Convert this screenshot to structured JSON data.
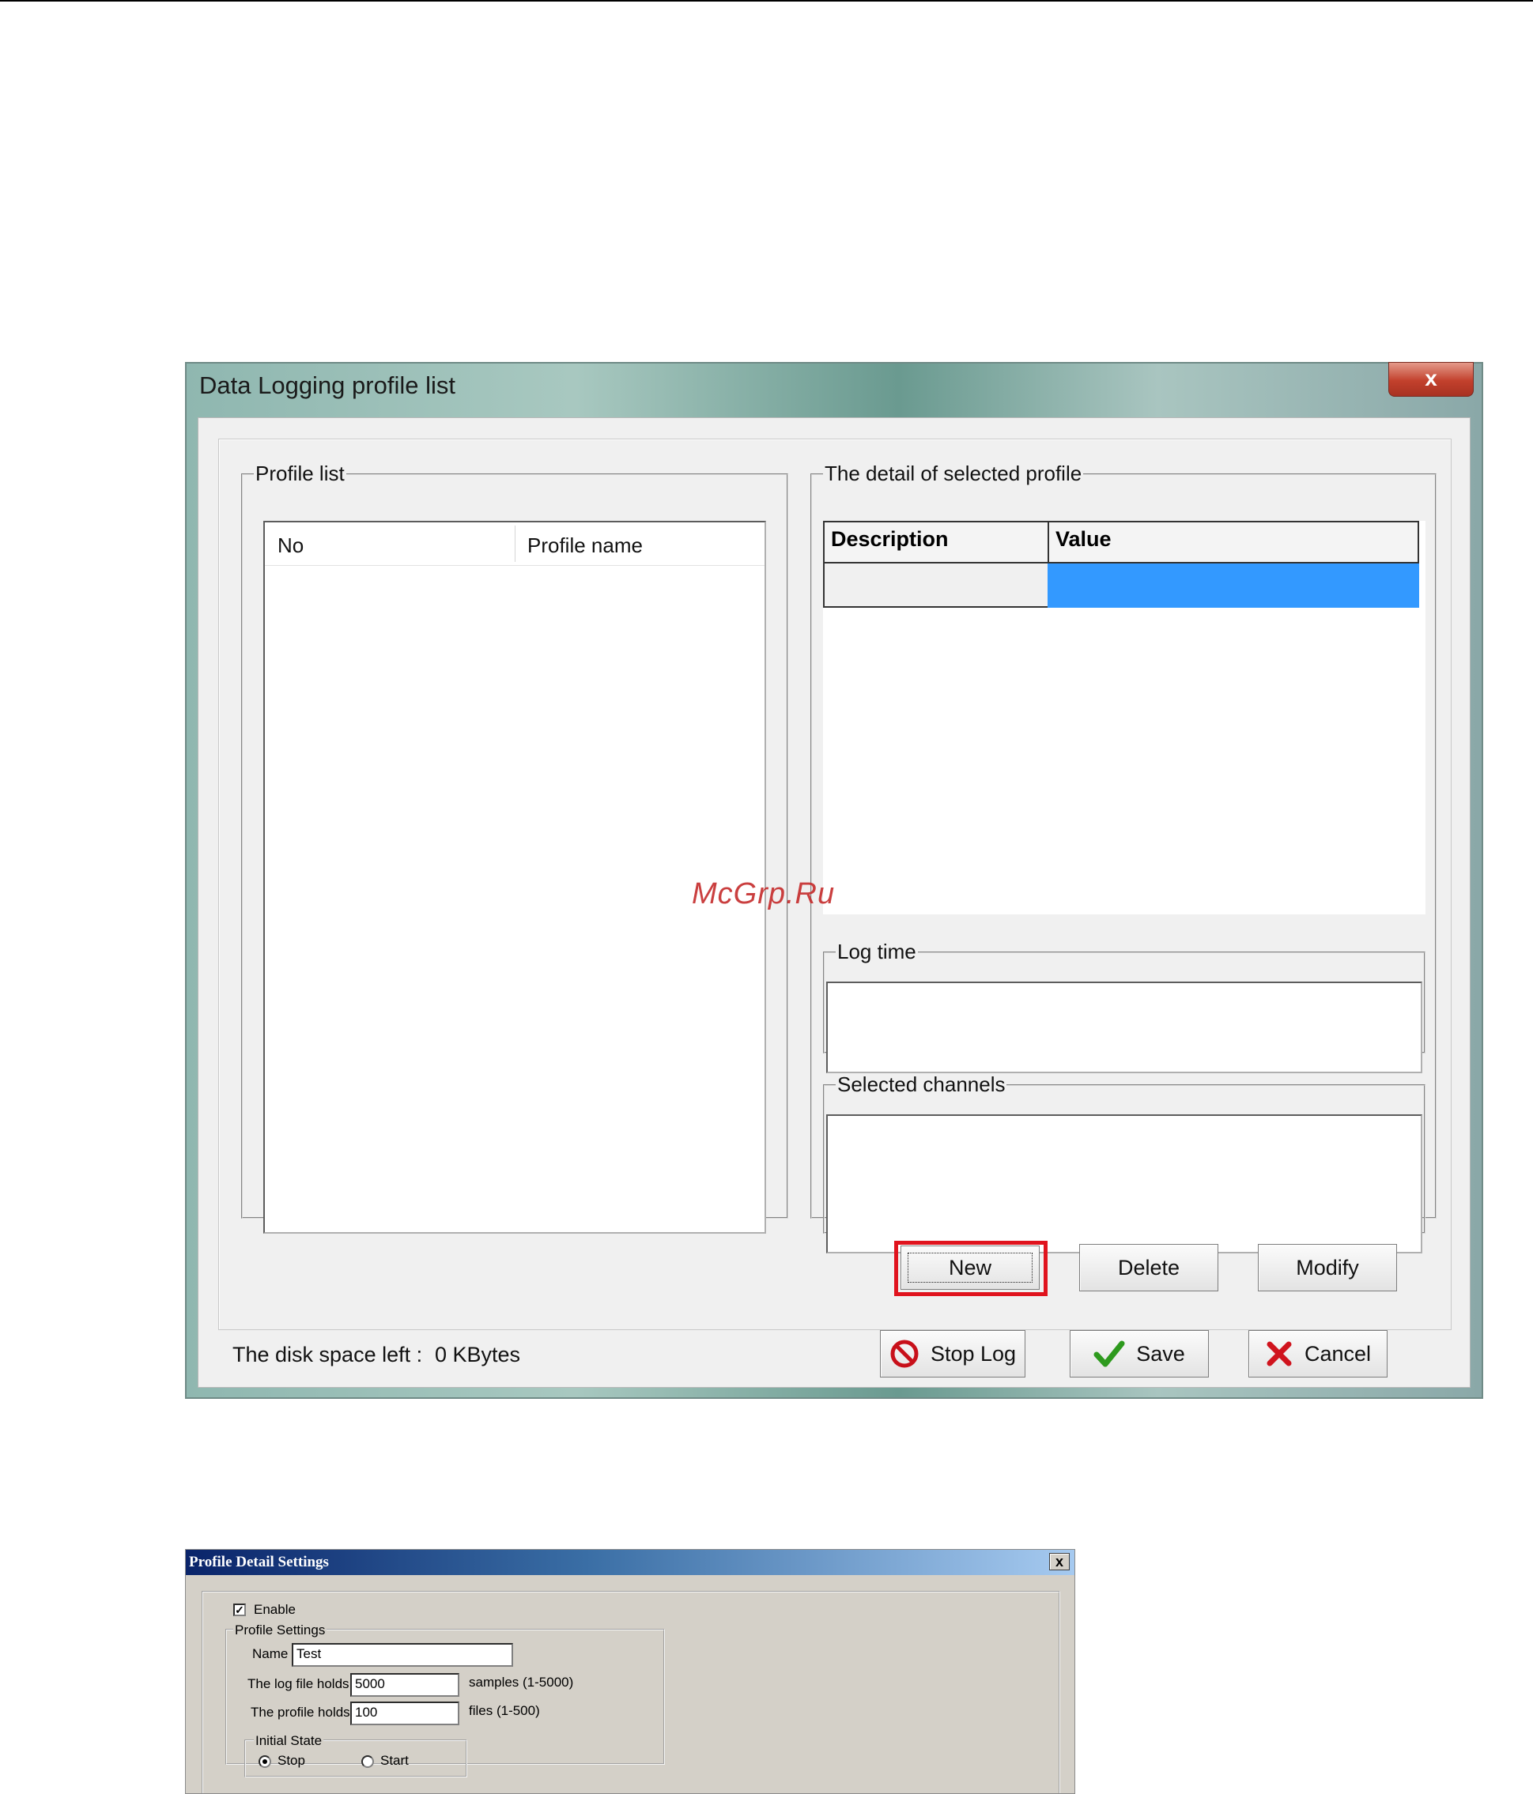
{
  "window1": {
    "title": "Data Logging profile list",
    "close_symbol": "x",
    "profile_list": {
      "legend": "Profile list",
      "columns": [
        "No",
        "Profile name"
      ]
    },
    "detail": {
      "legend": "The detail of selected profile",
      "columns": [
        "Description",
        "Value"
      ],
      "selected_color": "#3399ff"
    },
    "log_time": {
      "legend": "Log time"
    },
    "selected_channels": {
      "legend": "Selected channels"
    },
    "buttons": {
      "new": "New",
      "delete": "Delete",
      "modify": "Modify",
      "stop_log": "Stop Log",
      "save": "Save",
      "cancel": "Cancel"
    },
    "disk_space": {
      "label": "The disk space left :",
      "value": "0 KBytes"
    },
    "highlight_color": "#e0141e"
  },
  "watermark": "McGrp.Ru",
  "window2": {
    "title": "Profile Detail Settings",
    "close_symbol": "x",
    "enable_label": "Enable",
    "profile_settings_legend": "Profile Settings",
    "name_label": "Name",
    "name_value": "Test",
    "log_file_label": "The log file holds",
    "log_file_value": "5000",
    "log_file_unit": "samples (1-5000)",
    "profile_holds_label": "The profile holds",
    "profile_holds_value": "100",
    "profile_holds_unit": "files (1-500)",
    "initial_state_legend": "Initial State",
    "stop_label": "Stop",
    "start_label": "Start"
  }
}
